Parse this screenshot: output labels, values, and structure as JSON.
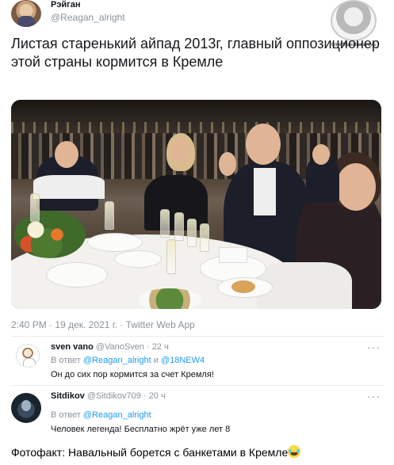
{
  "tweet": {
    "display_name": "Рэйган",
    "handle": "@Reagan_alright",
    "text": "Листая старенький айпад 2013г, главный оппозиционер этой страны кормится в Кремле",
    "time": "2:40 PM",
    "separator": "·",
    "date": "19 дек. 2021 г.",
    "source": "Twitter Web App",
    "photo_icon": "photo"
  },
  "watermark": {
    "label": "t.me/MuesliLavrova",
    "icon": "avatar-stamp-icon"
  },
  "replies": [
    {
      "name": "sven vano",
      "handle": "@VanoSven",
      "age": "· 22 ч",
      "reply_prefix": "В ответ",
      "reply_to_1": "@Reagan_alright",
      "reply_joiner": "и",
      "reply_to_2": "@18NEW4",
      "text": "Он до сих пор кормится за счет Кремля!",
      "more": "···"
    },
    {
      "name": "Sitdikov",
      "handle": "@Sitdikov709",
      "age": "· 20 ч",
      "reply_prefix": "В ответ",
      "reply_to_1": "@Reagan_alright",
      "text": "Человек легенда! Бесплатно жрёт уже лет 8",
      "more": "···"
    }
  ],
  "caption": {
    "text": "Фотофакт: Навальный борется с банкетами в Кремле",
    "emoji": "laughing-tears-emoji"
  },
  "colors": {
    "link": "#1d9bf0",
    "muted": "#8a949c",
    "text": "#0f1419"
  }
}
